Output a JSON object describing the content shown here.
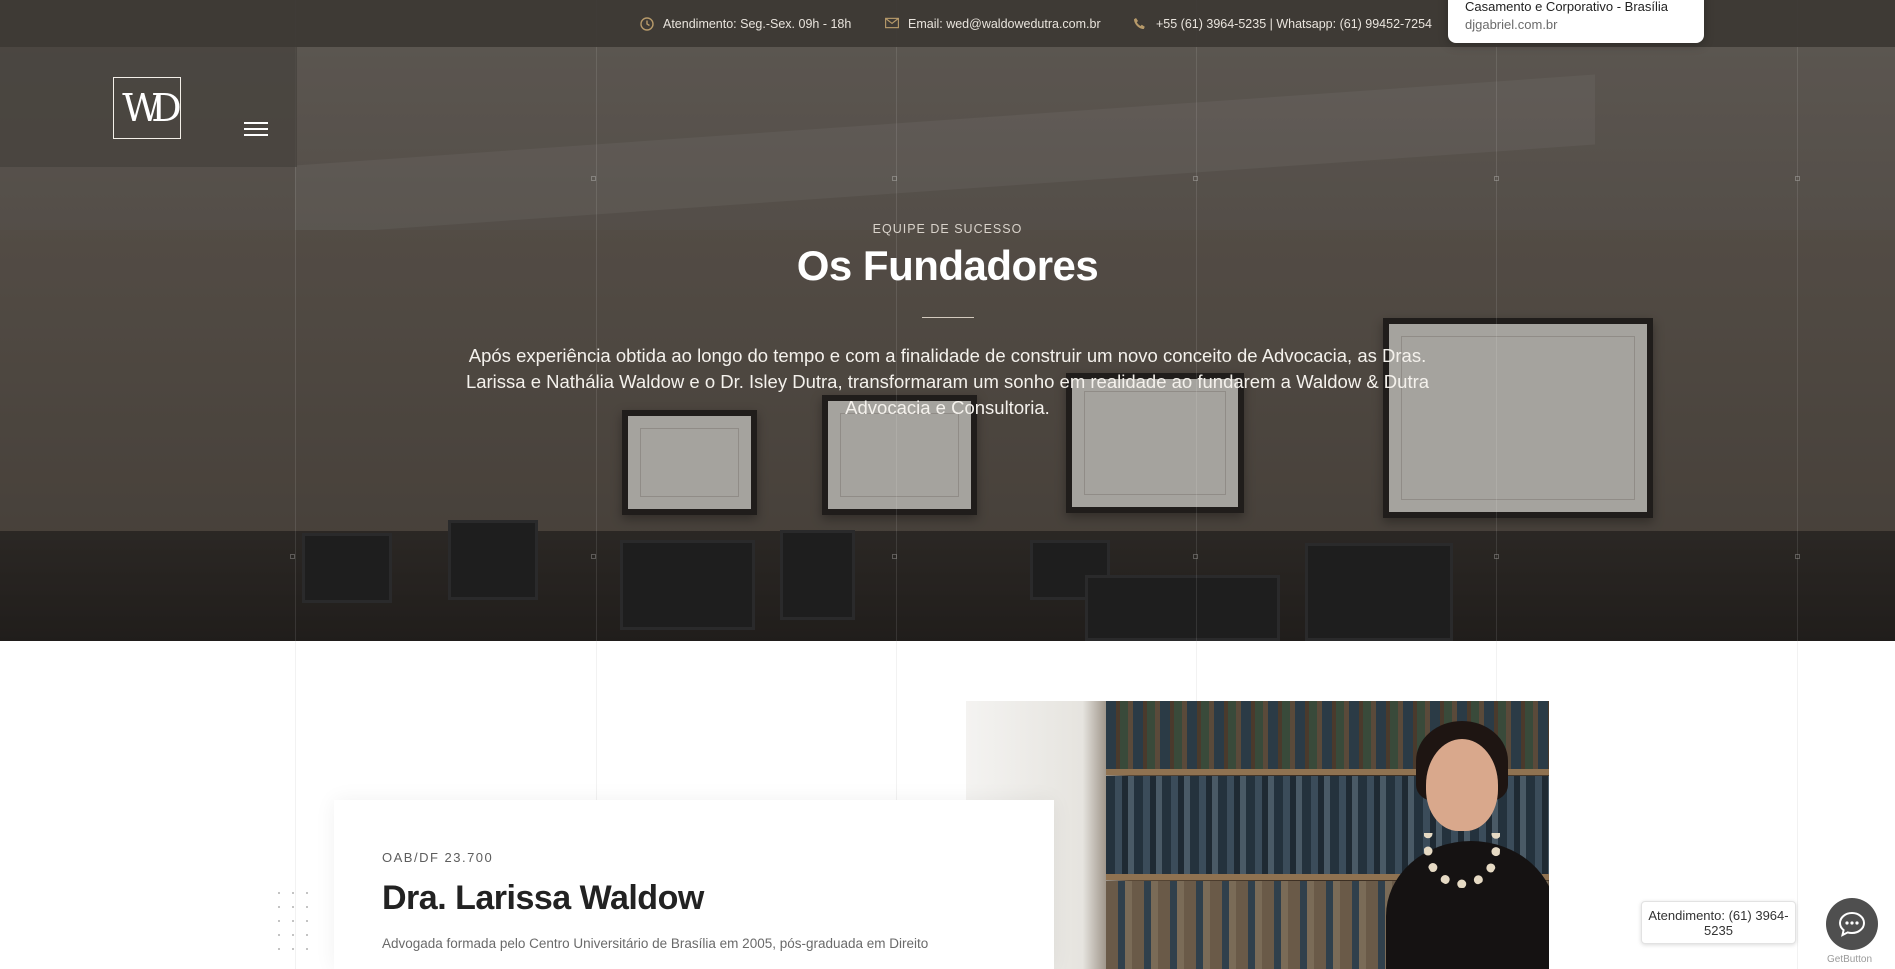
{
  "topbar": {
    "hours": "Atendimento: Seg.-Sex. 09h - 18h",
    "email": "Email: wed@waldowedutra.com.br",
    "phone": "+55 (61) 3964-5235 | Whatsapp: (61) 99452-7254",
    "icons": [
      "clock-icon",
      "envelope-icon",
      "phone-icon"
    ]
  },
  "ad_popup": {
    "title": "Casamento e Corporativo - Brasília",
    "url": "djgabriel.com.br"
  },
  "logo": {
    "text": "WD"
  },
  "hero": {
    "eyebrow": "EQUIPE DE SUCESSO",
    "title": "Os Fundadores",
    "description": "Após experiência obtida ao longo do tempo e com a finalidade de construir um novo conceito de Advocacia, as Dras. Larissa e Nathália Waldow e o Dr. Isley Dutra, transformaram um sonho em realidade ao fundarem a Waldow & Dutra Advocacia e Consultoria."
  },
  "profile": {
    "oab": "OAB/DF 23.700",
    "name": "Dra. Larissa Waldow",
    "bio": "Advogada formada pelo Centro Universitário de Brasília em 2005, pós-graduada em Direito"
  },
  "chat": {
    "bubble": "Atendimento: (61) 3964-5235",
    "brand": "GetButton"
  },
  "colors": {
    "accent": "#b79a6a",
    "topbar": "#3c3733"
  }
}
